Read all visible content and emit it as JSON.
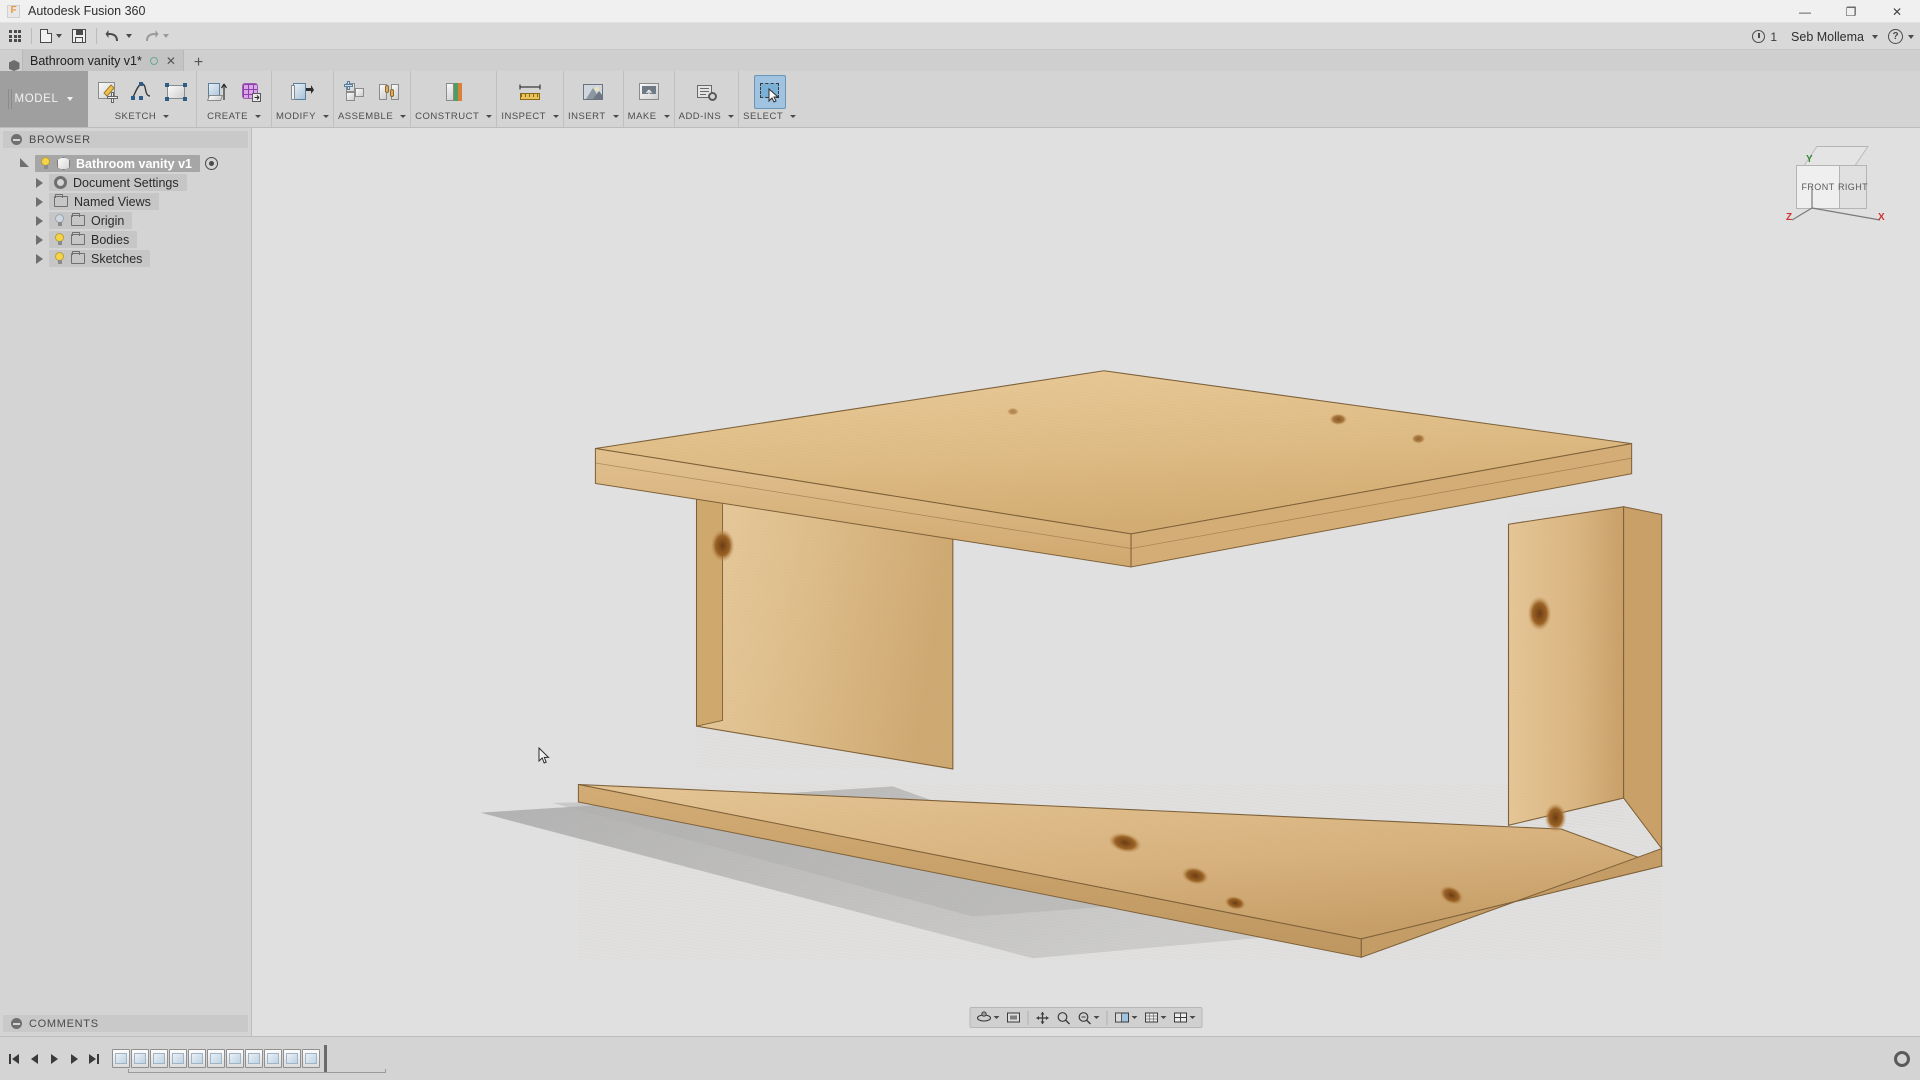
{
  "titlebar": {
    "app_title": "Autodesk Fusion 360",
    "logo_letter": "F",
    "minimize": "—",
    "maximize": "❐",
    "close": "✕"
  },
  "quick_access": {
    "app_grid_label": "app-grid",
    "new_doc_label": "new-document",
    "save_label": "save",
    "undo_label": "undo",
    "redo_label": "redo",
    "job_count": "1",
    "user_name": "Seb Mollema",
    "help_label": "?"
  },
  "tabs": {
    "documents": [
      {
        "title": "Bathroom vanity v1*",
        "dirty": true
      }
    ],
    "new_tab_label": "+"
  },
  "workspace": {
    "label": "MODEL"
  },
  "ribbon": {
    "groups": [
      {
        "label": "SKETCH",
        "tools": [
          {
            "name": "create-sketch-icon",
            "title": "Create Sketch"
          },
          {
            "name": "spline-icon",
            "title": "Spline"
          },
          {
            "name": "rectangle-icon",
            "title": "Rectangle"
          }
        ]
      },
      {
        "label": "CREATE",
        "tools": [
          {
            "name": "extrude-icon",
            "title": "Extrude"
          },
          {
            "name": "form-icon",
            "title": "Create Form"
          }
        ]
      },
      {
        "label": "MODIFY",
        "tools": [
          {
            "name": "press-pull-icon",
            "title": "Press Pull"
          }
        ]
      },
      {
        "label": "ASSEMBLE",
        "tools": [
          {
            "name": "new-component-icon",
            "title": "New Component"
          },
          {
            "name": "joint-icon",
            "title": "Joint"
          }
        ]
      },
      {
        "label": "CONSTRUCT",
        "tools": [
          {
            "name": "offset-plane-icon",
            "title": "Offset Plane"
          }
        ]
      },
      {
        "label": "INSPECT",
        "tools": [
          {
            "name": "measure-icon",
            "title": "Measure"
          }
        ]
      },
      {
        "label": "INSERT",
        "tools": [
          {
            "name": "insert-image-icon",
            "title": "Insert Image"
          }
        ]
      },
      {
        "label": "MAKE",
        "tools": [
          {
            "name": "3d-print-icon",
            "title": "3D Print"
          }
        ]
      },
      {
        "label": "ADD-INS",
        "tools": [
          {
            "name": "scripts-addins-icon",
            "title": "Scripts and Add-Ins"
          }
        ]
      },
      {
        "label": "SELECT",
        "tools": [
          {
            "name": "select-icon",
            "title": "Select",
            "active": true
          }
        ]
      }
    ]
  },
  "browser": {
    "header": "BROWSER",
    "tree": [
      {
        "label": "Bathroom vanity v1",
        "depth": 0,
        "selected": true,
        "expander": "open",
        "bulb": "on",
        "icon": "component-cube-icon",
        "target": true
      },
      {
        "label": "Document Settings",
        "depth": 1,
        "selected": false,
        "expander": "closed",
        "bulb": null,
        "icon": "gear-icon",
        "target": false
      },
      {
        "label": "Named Views",
        "depth": 1,
        "selected": false,
        "expander": "closed",
        "bulb": null,
        "icon": "folder-icon",
        "target": false
      },
      {
        "label": "Origin",
        "depth": 1,
        "selected": false,
        "expander": "closed",
        "bulb": "off",
        "icon": "folder-icon",
        "target": false
      },
      {
        "label": "Bodies",
        "depth": 1,
        "selected": false,
        "expander": "closed",
        "bulb": "on",
        "icon": "folder-icon",
        "target": false
      },
      {
        "label": "Sketches",
        "depth": 1,
        "selected": false,
        "expander": "closed",
        "bulb": "on",
        "icon": "folder-icon",
        "target": false
      }
    ],
    "comments": "COMMENTS"
  },
  "viewcube": {
    "front": "FRONT",
    "right": "RIGHT",
    "axis_x": "X",
    "axis_z": "Z",
    "axis_y": "Y"
  },
  "navbar": {
    "buttons": [
      {
        "name": "orbit-icon",
        "title": "Orbit",
        "caret": true
      },
      {
        "name": "look-at-icon",
        "title": "Look At",
        "caret": false
      },
      {
        "name": "pan-icon",
        "title": "Pan",
        "caret": false
      },
      {
        "name": "zoom-icon",
        "title": "Zoom",
        "caret": false
      },
      {
        "name": "zoom-window-icon",
        "title": "Zoom Window",
        "caret": true
      },
      {
        "name": "display-settings-icon",
        "title": "Display Settings",
        "caret": true
      },
      {
        "name": "grid-snaps-icon",
        "title": "Grid and Snaps",
        "caret": true
      },
      {
        "name": "viewports-icon",
        "title": "Viewports",
        "caret": true
      }
    ]
  },
  "timeline": {
    "go_to_start": "go-to-beginning",
    "step_back": "step-backward",
    "play": "play",
    "step_forward": "step-forward",
    "go_to_end": "go-to-end",
    "feature_count": 11,
    "settings_label": "timeline-settings"
  },
  "colors": {
    "window_chrome": "#f0f0f0",
    "ribbon_bg": "#d4d4d4",
    "panel_bg": "#d4d4d4",
    "canvas_bg": "#e0e0e0",
    "accent_select": "#9fc3e0",
    "wood_light": "#e3c08a",
    "wood_mid": "#d4ac74",
    "wood_dark": "#c39a63",
    "shadow": "#b4b4b4"
  }
}
